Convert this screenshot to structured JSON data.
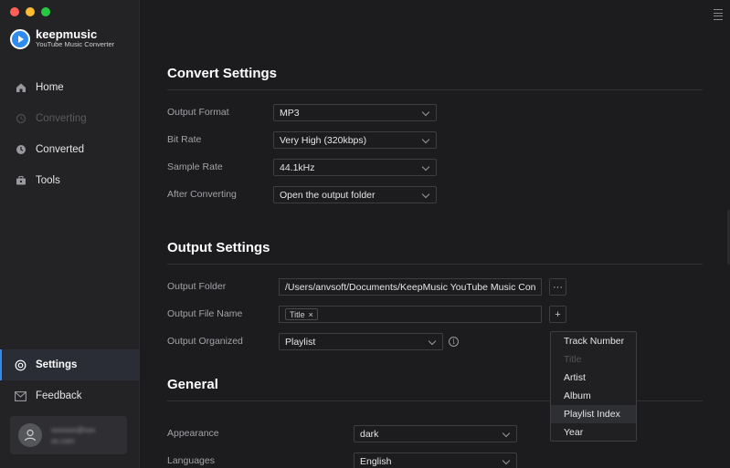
{
  "window": {
    "traffic_colors": {
      "close": "#ff5f57",
      "minimize": "#febc2e",
      "zoom": "#28c840"
    },
    "accent": "#2e8cf0"
  },
  "brand": {
    "name": "keepmusic",
    "subtitle": "YouTube Music Converter"
  },
  "sidebar": {
    "items": [
      {
        "label": "Home",
        "icon": "home-icon",
        "state": "normal"
      },
      {
        "label": "Converting",
        "icon": "converting-icon",
        "state": "disabled"
      },
      {
        "label": "Converted",
        "icon": "clock-icon",
        "state": "normal"
      },
      {
        "label": "Tools",
        "icon": "toolbox-icon",
        "state": "normal"
      },
      {
        "label": "Settings",
        "icon": "settings-icon",
        "state": "active"
      },
      {
        "label": "Feedback",
        "icon": "mail-icon",
        "state": "normal"
      }
    ],
    "user": {
      "email_line1": "xxxxxxx@xxx",
      "email_line2": "xx.com"
    }
  },
  "convert_settings": {
    "title": "Convert Settings",
    "output_format": {
      "label": "Output Format",
      "value": "MP3"
    },
    "bit_rate": {
      "label": "Bit Rate",
      "value": "Very High (320kbps)"
    },
    "sample_rate": {
      "label": "Sample Rate",
      "value": "44.1kHz"
    },
    "after_converting": {
      "label": "After Converting",
      "value": "Open the output folder"
    }
  },
  "output_settings": {
    "title": "Output Settings",
    "output_folder": {
      "label": "Output Folder",
      "value": "/Users/anvsoft/Documents/KeepMusic YouTube Music Con",
      "browse": "···"
    },
    "output_file_name": {
      "label": "Output File Name",
      "tag": "Title",
      "tag_remove": "×",
      "add": "+"
    },
    "output_organized": {
      "label": "Output Organized",
      "value": "Playlist",
      "info": "i",
      "options": [
        {
          "label": "Track Number",
          "state": "normal"
        },
        {
          "label": "Title",
          "state": "disabled"
        },
        {
          "label": "Artist",
          "state": "normal"
        },
        {
          "label": "Album",
          "state": "normal"
        },
        {
          "label": "Playlist Index",
          "state": "hover"
        },
        {
          "label": "Year",
          "state": "normal"
        }
      ]
    }
  },
  "general": {
    "title": "General",
    "appearance": {
      "label": "Appearance",
      "value": "dark"
    },
    "languages": {
      "label": "Languages",
      "value": "English"
    }
  }
}
